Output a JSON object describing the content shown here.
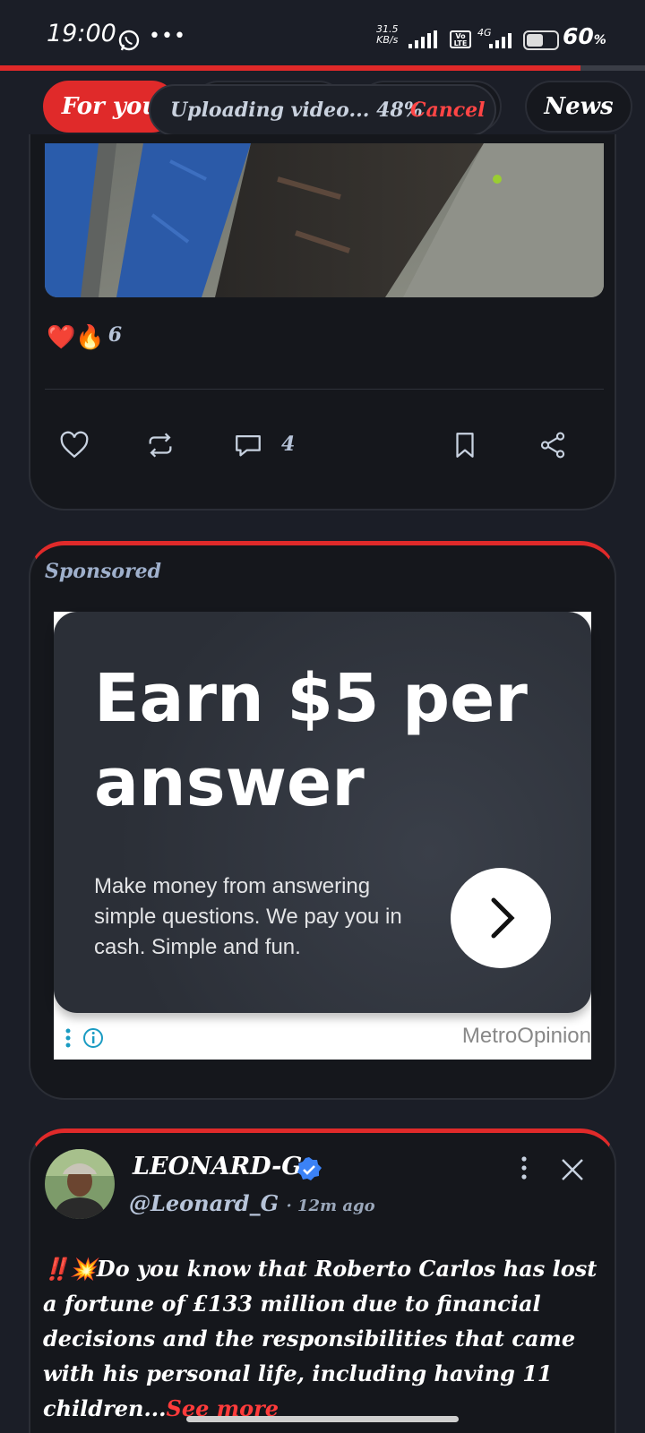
{
  "status_bar": {
    "time": "19:00",
    "speed_value": "31.5",
    "speed_unit": "KB/s",
    "network": "4G",
    "volte": "Vo LTE",
    "battery_pct": "60",
    "battery_symbol": "%",
    "battery_level": 0.6
  },
  "upload": {
    "progress": 0.9,
    "text": "Uploading video... 48%",
    "cancel_label": "Cancel"
  },
  "tabs": [
    {
      "label": "For you",
      "active": true
    },
    {
      "label": "",
      "active": false
    },
    {
      "label": "",
      "active": false
    },
    {
      "label": "News",
      "active": false
    }
  ],
  "post1": {
    "reaction_emojis": "❤️🔥",
    "reaction_count": "6",
    "comment_count": "4"
  },
  "ad": {
    "sponsored_label": "Sponsored",
    "headline": "Earn $5 per answer",
    "body": "Make money from answering simple questions. We pay you in cash. Simple and fun.",
    "brand": "MetroOpinion"
  },
  "post2": {
    "author": "LEONARD-G",
    "handle": "@Leonard_G",
    "time_ago": "· 12m ago",
    "text": "‼️💥Do you know  that Roberto Carlos has lost a fortune of £133 million due to financial decisions and the responsibilities that came with his personal life, including having 11 children...",
    "see_more": "See more"
  },
  "colors": {
    "accent": "#e02a2a",
    "background": "#1b1e27",
    "card": "#15171c",
    "verified": "#3b82f6"
  }
}
